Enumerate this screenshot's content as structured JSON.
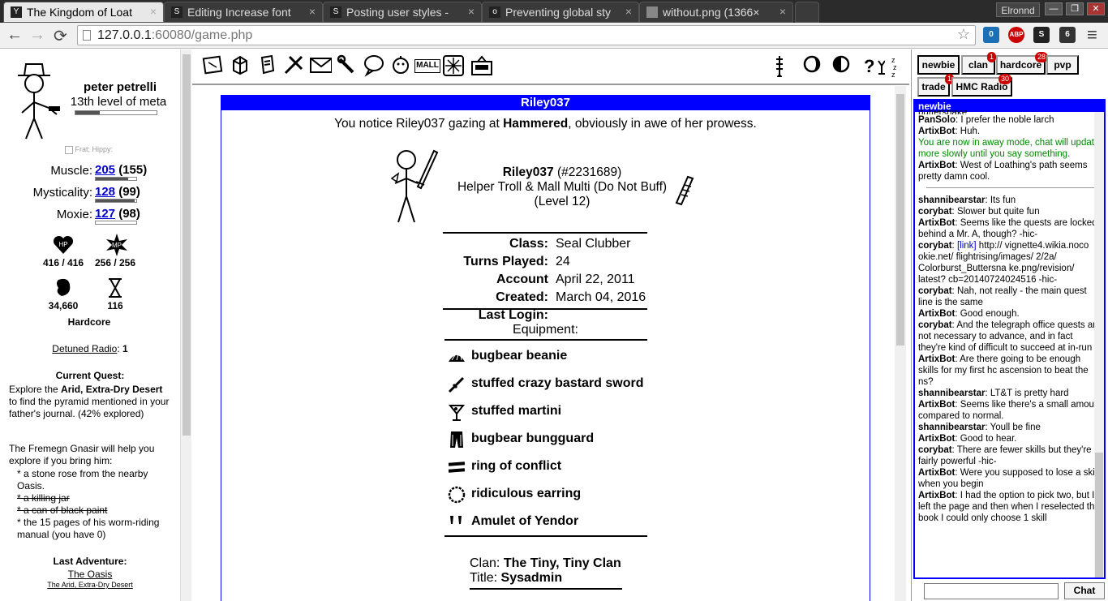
{
  "browser": {
    "tabs": [
      {
        "title": "The Kingdom of Loat",
        "icon": "Y"
      },
      {
        "title": "Editing Increase font",
        "icon": "S"
      },
      {
        "title": "Posting user styles -",
        "icon": "S"
      },
      {
        "title": "Preventing global sty",
        "icon": "o"
      },
      {
        "title": "without.png (1366×",
        "icon": ""
      }
    ],
    "close_glyph": "×",
    "user": "Elronnd",
    "win_min": "—",
    "win_max": "❐",
    "win_close": "✕",
    "url_host": "127.0.0.1",
    "url_path": ":60080/game.php",
    "back": "←",
    "forward": "→",
    "reload": "⟳",
    "star": "☆",
    "menu": "≡",
    "ext_icons": [
      {
        "name": "ghostery",
        "label": "0",
        "color": "#1a6fb5"
      },
      {
        "name": "adblock-plus",
        "label": "ABP",
        "color": "#c00"
      },
      {
        "name": "stylish",
        "label": "S",
        "color": "#222"
      },
      {
        "name": "extension",
        "label": "6",
        "color": "#333"
      }
    ]
  },
  "character": {
    "name": "peter petrelli",
    "title": "13th level of meta",
    "level_progress": 0.3,
    "path_checkbox_label": "Frat; Hippy:",
    "stats": [
      {
        "label": "Muscle:",
        "buffed": "205",
        "base": "(155)",
        "progress": 0.8
      },
      {
        "label": "Mysticality:",
        "buffed": "128",
        "base": "(99)",
        "progress": 0.95
      },
      {
        "label": "Moxie:",
        "buffed": "127",
        "base": "(98)",
        "progress": 0.0
      }
    ],
    "hp_icon": "HP",
    "mp_icon": "MP",
    "hp": "416 / 416",
    "mp": "256 / 256",
    "meat": "34,660",
    "adventures": "116",
    "mode": "Hardcore",
    "radio_label": "Detuned Radio",
    "radio_colon": ":",
    "radio_value": "1",
    "quest_heading": "Current Quest:",
    "quest1_a": "Explore the ",
    "quest1_b": "Arid, Extra-Dry Desert",
    "quest1_c": " to find the pyramid mentioned in your father's journal. (42% explored)",
    "quest2": "The Fremegn Gnasir will help you explore if you bring him:",
    "quest_items": [
      {
        "text": "* a stone rose from the nearby Oasis.",
        "done": false
      },
      {
        "text": "* a killing jar",
        "done": true
      },
      {
        "text": "* a can of black paint",
        "done": true
      },
      {
        "text": "* the 15 pages of his worm-riding manual (you have 0)",
        "done": false
      }
    ],
    "last_adv_heading": "Last Adventure:",
    "last_adv": "The Oasis",
    "last_adv_zone": "The Arid, Extra-Dry Desert"
  },
  "awesomebar": {
    "icons": [
      "inventory-icon",
      "bag-icon",
      "book-icon",
      "craft-icon",
      "mail-icon",
      "wrench-icon",
      "chat-bubble-icon",
      "familiar-icon",
      "mall-icon",
      "compass-icon",
      "radio-icon"
    ],
    "mall": "MALL",
    "right_icons": [
      "thermometer-icon",
      "moon-icon",
      "moon2-icon",
      "help-icon",
      "sleep-icon"
    ]
  },
  "profile": {
    "header": "Riley037",
    "notice_a": "You notice Riley037 gazing at ",
    "notice_b": "Hammered",
    "notice_c": ", obviously in awe of her prowess.",
    "name": "Riley037",
    "id": "(#2231689)",
    "desc": "Helper Troll & Mall Multi (Do Not Buff)",
    "level": "(Level 12)",
    "info": [
      {
        "label": "Class:",
        "value": "Seal Clubber"
      },
      {
        "label": "Turns Played:",
        "value": "24"
      },
      {
        "label": "Account Created:",
        "value": "April 22, 2011"
      },
      {
        "label": "Last Login:",
        "value": "March 04, 2016"
      }
    ],
    "equipment_heading": "Equipment:",
    "equipment": [
      {
        "name": "bugbear beanie",
        "icon": "hat-icon"
      },
      {
        "name": "stuffed crazy bastard sword",
        "icon": "sword-icon"
      },
      {
        "name": "stuffed martini",
        "icon": "martini-icon"
      },
      {
        "name": "bugbear bungguard",
        "icon": "pants-icon"
      },
      {
        "name": "ring of conflict",
        "icon": "ring-icon"
      },
      {
        "name": "ridiculous earring",
        "icon": "earring-icon"
      },
      {
        "name": "Amulet of Yendor",
        "icon": "amulet-icon"
      }
    ],
    "clan_label": "Clan:",
    "clan": "The Tiny, Tiny Clan",
    "title_label": "Title:",
    "title": "Sysadmin"
  },
  "chat": {
    "tabs": [
      {
        "label": "newbie",
        "badge": ""
      },
      {
        "label": "clan",
        "badge": "1"
      },
      {
        "label": "hardcore",
        "badge": "28"
      },
      {
        "label": "pvp",
        "badge": ""
      },
      {
        "label": "trade",
        "badge": "1"
      },
      {
        "label": "HMC Radio",
        "badge": "30"
      }
    ],
    "channel": "newbie",
    "partial_top": "buttershake",
    "messages": [
      {
        "who": "PanSolo",
        "text": "I prefer the noble larch"
      },
      {
        "who": "ArtixBot",
        "text": "Huh."
      },
      {
        "system": "You are now in away mode, chat will update more slowly until you say something."
      },
      {
        "who": "ArtixBot",
        "text": "West of Loathing's path seems pretty damn cool."
      },
      {
        "divider": true
      },
      {
        "who": "shannibearstar",
        "text": "Its fun"
      },
      {
        "who": "corybat",
        "text": "Slower but quite fun"
      },
      {
        "who": "ArtixBot",
        "text": "Seems like the quests are locked behind a Mr. A, though? -hic-"
      },
      {
        "who": "corybat",
        "link": "[link]",
        "text": "http:// vignette4.wikia.noco okie.net/ flightrising/images/ 2/2a/ Colorburst_Buttersna ke.png/revision/ latest? cb=20140724024516 -hic-"
      },
      {
        "who": "corybat",
        "text": "Nah, not really - the main quest line is the same"
      },
      {
        "who": "ArtixBot",
        "text": "Good enough."
      },
      {
        "who": "corybat",
        "text": "And the telegraph office quests are not necessary to advance, and in fact they're kind of difficult to succeed at in-run"
      },
      {
        "who": "ArtixBot",
        "text": "Are there going to be enough skills for my first hc ascension to beat the ns?"
      },
      {
        "who": "shannibearstar",
        "text": "LT&T is pretty hard"
      },
      {
        "who": "ArtixBot",
        "text": "Seems like there's a small amount compared to normal."
      },
      {
        "who": "shannibearstar",
        "text": "Youll be fine"
      },
      {
        "who": "ArtixBot",
        "text": "Good to hear."
      },
      {
        "who": "corybat",
        "text": "There are fewer skills but they're fairly powerful -hic-"
      },
      {
        "who": "ArtixBot",
        "text": "Were you supposed to lose a skill when you begin"
      },
      {
        "who": "ArtixBot",
        "text": "I had the option to pick two, but I left the page and then when I reselected the book I could only choose 1 skill"
      }
    ],
    "send_label": "Chat"
  }
}
